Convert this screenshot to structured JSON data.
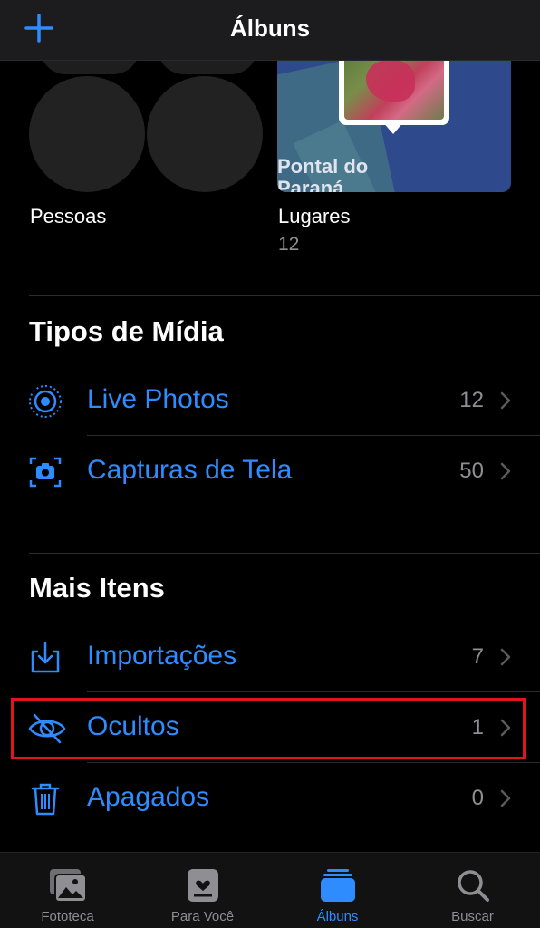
{
  "header": {
    "title": "Álbuns",
    "add_icon": "plus-icon"
  },
  "people_places": {
    "people": {
      "label": "Pessoas"
    },
    "places": {
      "label": "Lugares",
      "count": "12",
      "map_text": "Pontal do\nParaná"
    }
  },
  "media_types": {
    "title": "Tipos de Mídia",
    "items": [
      {
        "label": "Live Photos",
        "count": "12",
        "icon": "live-photo-icon"
      },
      {
        "label": "Capturas de Tela",
        "count": "50",
        "icon": "screenshot-icon"
      }
    ]
  },
  "more_items": {
    "title": "Mais Itens",
    "items": [
      {
        "label": "Importações",
        "count": "7",
        "icon": "import-icon"
      },
      {
        "label": "Ocultos",
        "count": "1",
        "icon": "eye-slash-icon",
        "highlighted": true
      },
      {
        "label": "Apagados",
        "count": "0",
        "icon": "trash-icon"
      }
    ]
  },
  "tabbar": {
    "tabs": [
      {
        "label": "Fototeca",
        "icon": "photos-library-icon",
        "active": false
      },
      {
        "label": "Para Você",
        "icon": "for-you-icon",
        "active": false
      },
      {
        "label": "Álbuns",
        "icon": "albums-icon",
        "active": true
      },
      {
        "label": "Buscar",
        "icon": "search-icon",
        "active": false
      }
    ]
  },
  "colors": {
    "accent": "#2f8cff",
    "highlight": "#e0161e",
    "secondary_text": "#8e8e93"
  }
}
